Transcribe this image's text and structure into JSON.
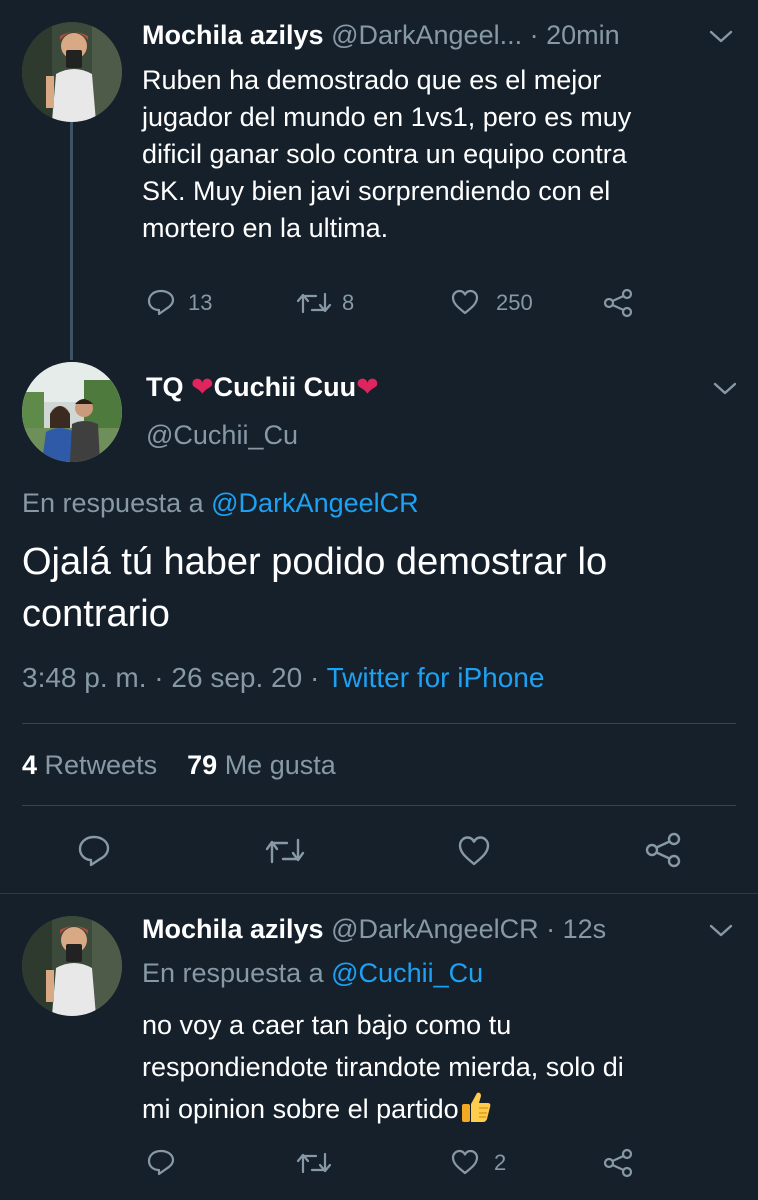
{
  "tweet1": {
    "display_name": "Mochila azilys",
    "handle": "@DarkAngeel...",
    "time": "20min",
    "lines": [
      "Ruben ha demostrado que es el mejor",
      "jugador del mundo en 1vs1, pero es muy",
      "dificil ganar solo contra un equipo contra",
      "SK. Muy bien javi sorprendiendo con el",
      "mortero en la ultima."
    ],
    "reply_count": "13",
    "retweet_count": "8",
    "like_count": "250"
  },
  "tweet2": {
    "name_prefix": "TQ",
    "name_middle": "Cuchii Cuu",
    "handle": "@Cuchii_Cu",
    "reply_to_label": "En respuesta a",
    "reply_to_handle": "@DarkAngeelCR",
    "text_lines": [
      "Ojalá tú haber podido demostrar lo",
      "contrario"
    ],
    "time": "3:48 p. m.",
    "date": "26 sep. 20",
    "source": "Twitter for iPhone",
    "sep": "·",
    "retweets_num": "4",
    "retweets_label": "Retweets",
    "likes_num": "79",
    "likes_label": "Me gusta"
  },
  "tweet3": {
    "display_name": "Mochila azilys",
    "handle": "@DarkAngeelCR",
    "time": "12s",
    "reply_to_label": "En respuesta a",
    "reply_to_handle": "@Cuchii_Cu",
    "lines": [
      "no voy a caer tan bajo como tu",
      "respondiendote tirandote mierda, solo di",
      "mi opinion sobre el partido"
    ],
    "like_count": "2"
  },
  "colors": {
    "background": "#15202b",
    "muted": "#8899a6",
    "link": "#1da1f2",
    "heart": "#e0245e"
  },
  "icons": [
    "reply-icon",
    "retweet-icon",
    "like-icon",
    "share-icon",
    "chevron-down-icon",
    "red-heart-emoji",
    "thumbs-up-emoji"
  ]
}
